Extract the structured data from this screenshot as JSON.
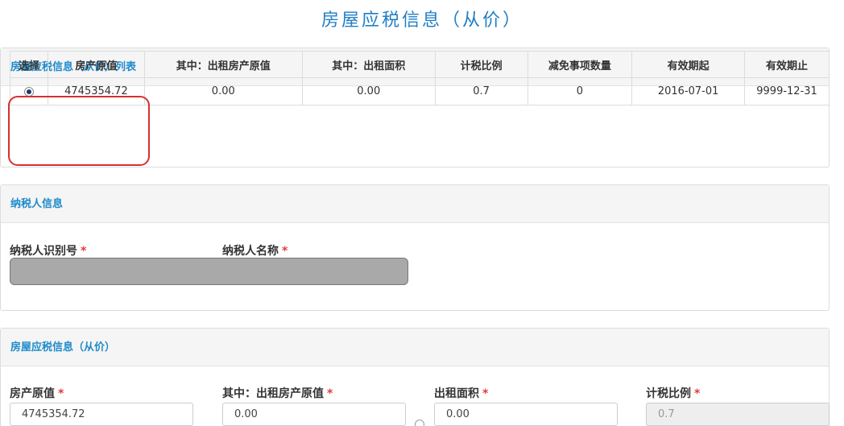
{
  "page_title": "房屋应税信息（从价）",
  "list_panel": {
    "heading": "房屋应税信息（从价）列表",
    "columns": [
      "选择",
      "房产原值",
      "其中：出租房产原值",
      "其中：出租面积",
      "计税比例",
      "减免事项数量",
      "有效期起",
      "有效期止"
    ],
    "rows": [
      {
        "selected": true,
        "original_value": "4745354.72",
        "rental_original_value": "0.00",
        "rental_area": "0.00",
        "tax_ratio": "0.7",
        "relief_count": "0",
        "valid_from": "2016-07-01",
        "valid_to": "9999-12-31"
      }
    ]
  },
  "taxpayer_panel": {
    "heading": "纳税人信息",
    "taxpayer_id_label": "纳税人识别号",
    "taxpayer_name_label": "纳税人名称",
    "required_mark": "*"
  },
  "info_panel": {
    "heading": "房屋应税信息（从价）",
    "required_mark": "*",
    "fields": {
      "original_value": {
        "label": "房产原值",
        "value": "4745354.72"
      },
      "rental_original_value": {
        "label": "其中：出租房产原值",
        "value": "0.00"
      },
      "rental_area": {
        "label": "出租面积",
        "value": "0.00"
      },
      "tax_ratio": {
        "label": "计税比例",
        "value": "0.7"
      }
    }
  },
  "colors": {
    "accent": "#1e8acb",
    "title": "#1f7fc5",
    "required": "#e03c3c",
    "highlight": "#d63031"
  }
}
